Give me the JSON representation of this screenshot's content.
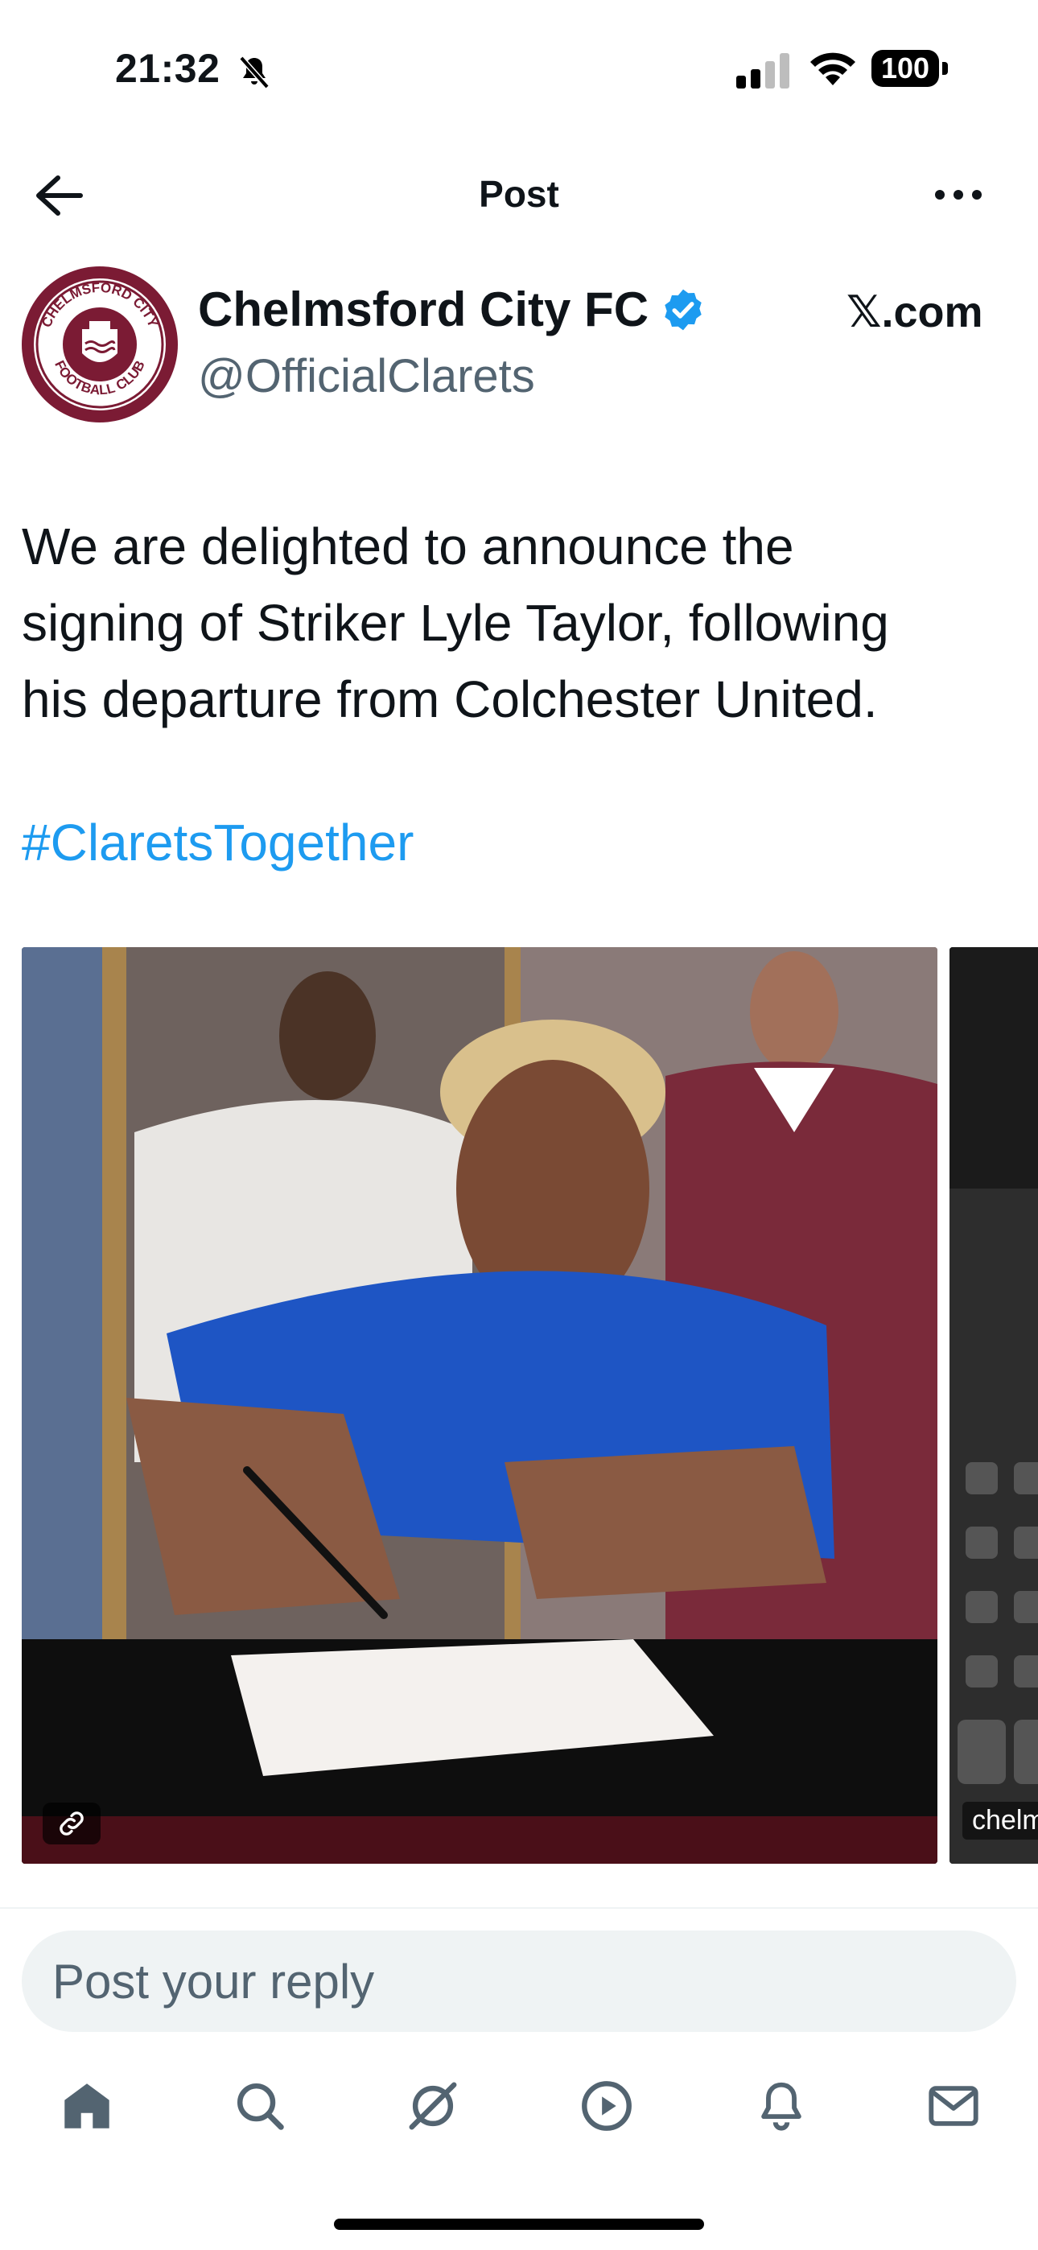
{
  "status_bar": {
    "time": "21:32",
    "battery": "100"
  },
  "nav": {
    "title": "Post"
  },
  "post": {
    "display_name": "Chelmsford City FC",
    "handle": "@OfficialClarets",
    "source": "𝕏.com",
    "text_lines": [
      "We are delighted to announce the",
      "signing of Striker Lyle Taylor, following",
      "his departure from Colchester United."
    ],
    "hashtag": "#ClaretsTogether",
    "avatar_text": {
      "top": "CHELMSFORD CITY",
      "bottom": "FOOTBALL CLUB"
    },
    "media": {
      "peek_label": "chelm"
    }
  },
  "reply": {
    "placeholder": "Post your reply"
  },
  "tabs": [
    {
      "name": "home",
      "icon": "home-icon"
    },
    {
      "name": "search",
      "icon": "search-icon"
    },
    {
      "name": "grok",
      "icon": "grok-icon"
    },
    {
      "name": "video",
      "icon": "play-icon"
    },
    {
      "name": "notifications",
      "icon": "bell-icon"
    },
    {
      "name": "messages",
      "icon": "mail-icon"
    }
  ],
  "colors": {
    "accent": "#1d9bf0",
    "text_primary": "#0f1419",
    "text_secondary": "#536471",
    "club_claret": "#7b1b34"
  }
}
